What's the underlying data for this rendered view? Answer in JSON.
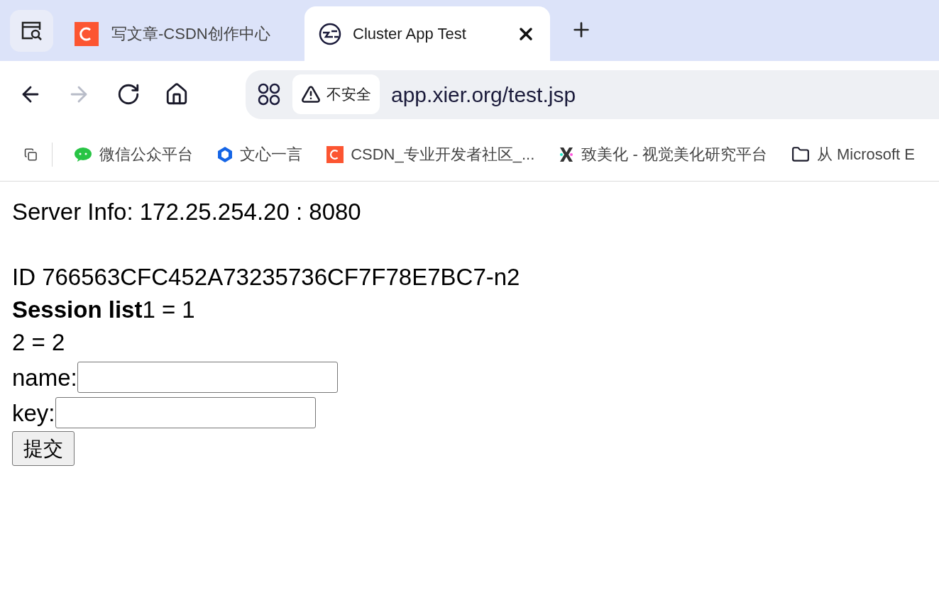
{
  "tabs": [
    {
      "title": "写文章-CSDN创作中心",
      "kind": "csdn",
      "selected": false,
      "closable": false
    },
    {
      "title": "Cluster App Test",
      "kind": "globe",
      "selected": true,
      "closable": true
    }
  ],
  "nav": {
    "back_disabled": false,
    "forward_disabled": true
  },
  "address": {
    "security": "不安全",
    "url": "app.xier.org/test.jsp"
  },
  "bookmarks": [
    {
      "label": "微信公众平台",
      "kind": "wechat"
    },
    {
      "label": "文心一言",
      "kind": "cube"
    },
    {
      "label": "CSDN_专业开发者社区_...",
      "kind": "csdn"
    },
    {
      "label": "致美化 - 视觉美化研究平台",
      "kind": "x"
    },
    {
      "label": "从 Microsoft E",
      "kind": "folder"
    }
  ],
  "page": {
    "server_info": "Server Info: 172.25.254.20 : 8080",
    "session_id": "ID 766563CFC452A73235736CF7F78E7BC7-n2",
    "session_lines": [
      "**Session list**1 = 1",
      "2 = 2"
    ],
    "fields": [
      {
        "label": "name:"
      },
      {
        "label": "key:"
      }
    ],
    "submit": "提交"
  }
}
